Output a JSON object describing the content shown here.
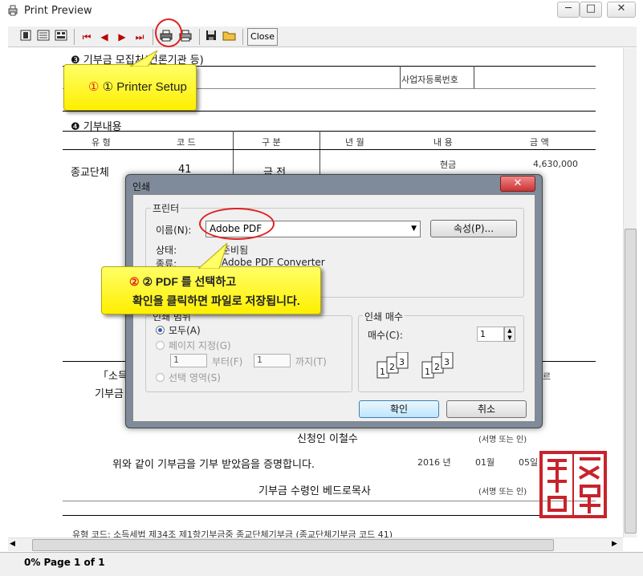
{
  "window": {
    "title": "Print Preview",
    "controls": [
      "─",
      "□",
      "✕"
    ]
  },
  "toolbar": {
    "icons": [
      "one-page-icon",
      "two-page-icon",
      "multi-page-icon",
      "first-page-icon",
      "prev-page-icon",
      "next-page-icon",
      "last-page-icon",
      "printer-setup-icon",
      "print-icon",
      "save-icon",
      "open-icon"
    ],
    "close_label": "Close"
  },
  "document": {
    "section3": "❸ 기부금 모집처(언론기관 등)",
    "biz_reg_label": "사업자등록번호",
    "section4": "❹ 기부내용",
    "columns": [
      "유  형",
      "코  드",
      "구  분",
      "년 월",
      "내  용",
      "금  액"
    ],
    "row": {
      "type": "종교단체",
      "code": "41",
      "kind": "금 전",
      "content": "현금",
      "amount": "4,630,000"
    },
    "frag_left1": "「소득",
    "frag_left2": "기부금",
    "frag_right": "르",
    "applicant": "신청인 이철수",
    "sign1": "(서명 또는 인)",
    "certify": "위와 같이 기부금을 기부 받았음을 증명합니다.",
    "year": "2016 년",
    "month": "01월",
    "day": "05일",
    "receiver": "기부금 수령인 베드로목사",
    "sign2": "(서명 또는 인)",
    "footer": "유형 코드:  소득세법 제34조 제1항기부금중 종교단체기부금  (종교단체기부금  코드 41)"
  },
  "callouts": {
    "printer_setup": "① Printer Setup",
    "pdf_line1": "② PDF 를 선택하고",
    "pdf_line2": "확인을  클릭하면 파일로 저장됩니다."
  },
  "dialog": {
    "title": "인쇄",
    "printer_group": "프린터",
    "name_label": "이름(N):",
    "name_value": "Adobe PDF",
    "properties_button": "속성(P)...",
    "status_label": "상태:",
    "status_value": "준비됨",
    "type_label": "종류:",
    "type_value": "Adobe PDF Converter",
    "range_group": "인쇄 범위",
    "range_all": "모두(A)",
    "range_pages": "페이지 지정(G)",
    "from_value": "1",
    "from_label": "부터(F)",
    "to_value": "1",
    "to_label": "까지(T)",
    "range_selection": "선택 영역(S)",
    "copies_group": "인쇄 매수",
    "copies_label": "매수(C):",
    "copies_value": "1",
    "ok_button": "확인",
    "cancel_button": "취소"
  },
  "status": {
    "text": "0%  Page 1 of 1"
  },
  "colors": {
    "callout": "#ffef00",
    "ring": "#e02020",
    "seal": "#c8232c"
  }
}
